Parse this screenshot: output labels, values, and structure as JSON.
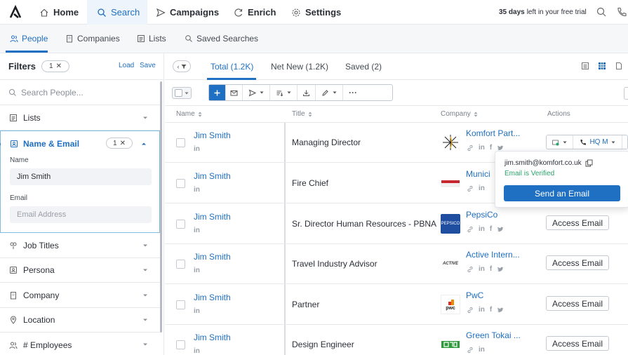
{
  "topnav": {
    "items": [
      {
        "label": "Home",
        "icon": "home-icon"
      },
      {
        "label": "Search",
        "icon": "search-icon"
      },
      {
        "label": "Campaigns",
        "icon": "send-icon"
      },
      {
        "label": "Enrich",
        "icon": "refresh-icon"
      },
      {
        "label": "Settings",
        "icon": "gear-icon"
      }
    ],
    "trial_days": "35 days",
    "trial_text": "left in your free trial",
    "accent": "#1f6fc2"
  },
  "subnav": {
    "items": [
      {
        "label": "People",
        "icon": "people-icon"
      },
      {
        "label": "Companies",
        "icon": "building-icon"
      },
      {
        "label": "Lists",
        "icon": "list-icon"
      },
      {
        "label": "Saved Searches",
        "icon": "saved-search-icon"
      }
    ]
  },
  "filters": {
    "title": "Filters",
    "count": "1",
    "load": "Load",
    "save": "Save",
    "search_placeholder": "Search People...",
    "lists": "Lists",
    "name_email": {
      "title": "Name & Email",
      "count": "1",
      "name_label": "Name",
      "name_value": "Jim Smith",
      "email_label": "Email",
      "email_placeholder": "Email Address"
    },
    "rows": [
      "Job Titles",
      "Persona",
      "Company",
      "Location",
      "# Employees"
    ]
  },
  "tabs": [
    "Total (1.2K)",
    "Net New (1.2K)",
    "Saved (2)"
  ],
  "table": {
    "headers": {
      "name": "Name",
      "title": "Title",
      "company": "Company",
      "actions": "Actions"
    },
    "rows": [
      {
        "name": "Jim Smith",
        "title": "Managing Director",
        "company": "Komfort Part...",
        "socials": [
          "link",
          "in",
          "f",
          "tw"
        ]
      },
      {
        "name": "Jim Smith",
        "title": "Fire Chief",
        "company": "Munici",
        "socials": [
          "link",
          "in"
        ]
      },
      {
        "name": "Jim Smith",
        "title": "Sr. Director Human Resources - PBNA",
        "company": "PepsiCo",
        "socials": [
          "link",
          "in",
          "f",
          "tw"
        ],
        "action": "Access Email"
      },
      {
        "name": "Jim Smith",
        "title": "Travel Industry Advisor",
        "company": "Active Intern...",
        "socials": [
          "link",
          "in",
          "f",
          "tw"
        ],
        "action": "Access Email"
      },
      {
        "name": "Jim Smith",
        "title": "Partner",
        "company": "PwC",
        "socials": [
          "link",
          "in",
          "f",
          "tw"
        ],
        "action": "Access Email"
      },
      {
        "name": "Jim Smith",
        "title": "Design Engineer",
        "company": "Green Tokai ...",
        "socials": [
          "link",
          "in"
        ],
        "action": "Access Email"
      }
    ],
    "li": "in",
    "row1_phone": "HQ M",
    "logo_texts": {
      "pepsico": "PEPSICO",
      "active": "ACTIVE",
      "pwc": "pwc"
    }
  },
  "popup": {
    "email": "jim.smith@komfort.co.uk",
    "status": "Email is Verified",
    "button": "Send an Email"
  }
}
